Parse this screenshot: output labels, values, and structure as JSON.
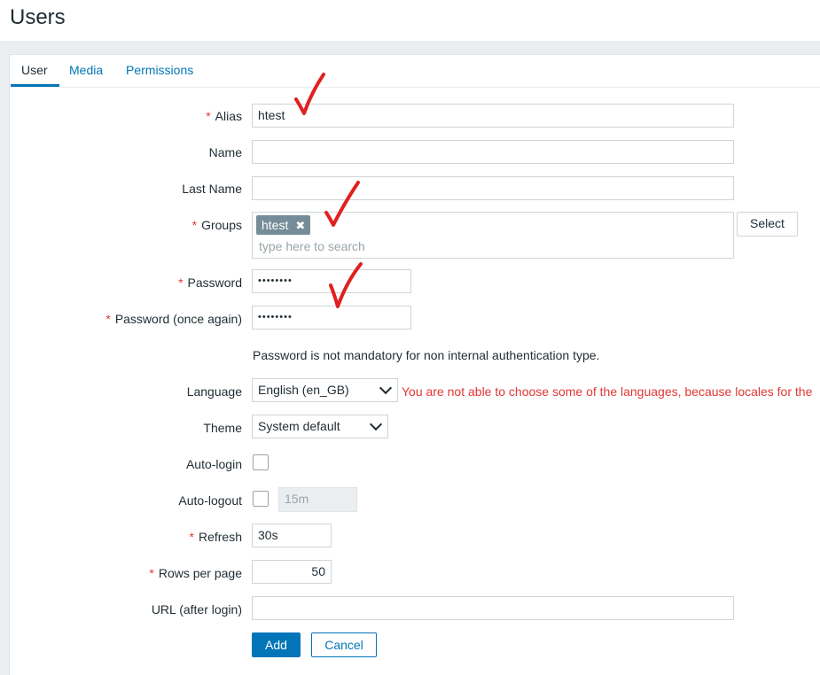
{
  "page": {
    "title": "Users"
  },
  "tabs": [
    {
      "label": "User",
      "active": true
    },
    {
      "label": "Media",
      "active": false
    },
    {
      "label": "Permissions",
      "active": false
    }
  ],
  "form": {
    "alias": {
      "label": "Alias",
      "required": "*",
      "value": "htest"
    },
    "name": {
      "label": "Name",
      "value": ""
    },
    "last_name": {
      "label": "Last Name",
      "value": ""
    },
    "groups": {
      "label": "Groups",
      "required": "*",
      "chips": [
        "htest"
      ],
      "placeholder": "type here to search",
      "select_label": "Select"
    },
    "password": {
      "label": "Password",
      "required": "*",
      "value": "••••••••"
    },
    "password_again": {
      "label": "Password (once again)",
      "required": "*",
      "value": "••••••••"
    },
    "password_hint": "Password is not mandatory for non internal authentication type.",
    "language": {
      "label": "Language",
      "value": "English (en_GB)",
      "error": "You are not able to choose some of the languages, because locales for the"
    },
    "theme": {
      "label": "Theme",
      "value": "System default"
    },
    "auto_login": {
      "label": "Auto-login",
      "checked": false
    },
    "auto_logout": {
      "label": "Auto-logout",
      "checked": false,
      "value": "15m"
    },
    "refresh": {
      "label": "Refresh",
      "required": "*",
      "value": "30s"
    },
    "rows_per_page": {
      "label": "Rows per page",
      "required": "*",
      "value": "50"
    },
    "url_after_login": {
      "label": "URL (after login)",
      "value": ""
    },
    "buttons": {
      "add": "Add",
      "cancel": "Cancel"
    }
  },
  "colors": {
    "accent": "#0275b8",
    "required": "#e33734",
    "chip": "#768d99",
    "annotation": "#e02020"
  },
  "annotations": [
    "checkmark-icon",
    "checkmark-icon",
    "checkmark-icon"
  ]
}
